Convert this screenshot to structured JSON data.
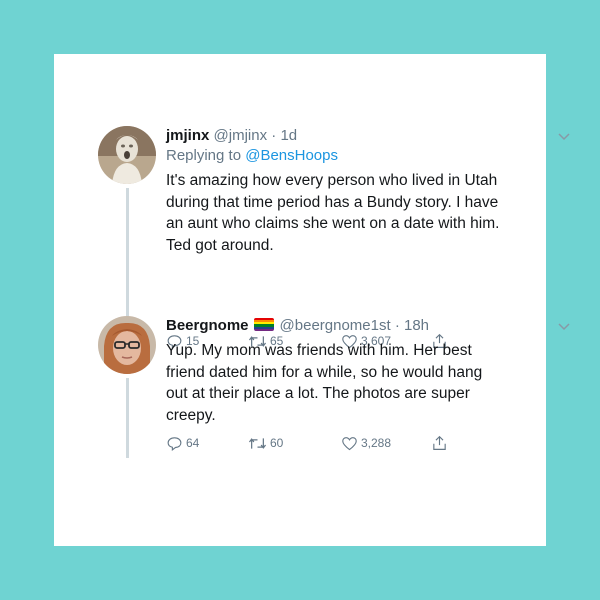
{
  "tweets": [
    {
      "name": "jmjinx",
      "handle": "@jmjinx",
      "time": "1d",
      "reply_prefix": "Replying to",
      "reply_to": "@BensHoops",
      "text": "It's amazing how every person who lived in Utah during that time period has a Bundy story. I have an aunt who claims she went on a date with him. Ted got around.",
      "replies": "15",
      "retweets": "65",
      "likes": "3,607"
    },
    {
      "name": "Beergnome",
      "handle": "@beergnome1st",
      "time": "18h",
      "text": "Yup. My mom was friends with him. Her best friend dated him for a while, so he would hang out at their place a lot. The photos are super creepy.",
      "replies": "64",
      "retweets": "60",
      "likes": "3,288"
    }
  ],
  "colors": {
    "frame": "#6fd3d2",
    "card": "#ffffff",
    "text": "#14171a",
    "muted": "#657786",
    "link": "#1b95e0"
  },
  "icons": [
    "chevron-down-icon",
    "reply-icon",
    "retweet-icon",
    "like-icon",
    "share-icon",
    "rainbow-flag-icon"
  ]
}
